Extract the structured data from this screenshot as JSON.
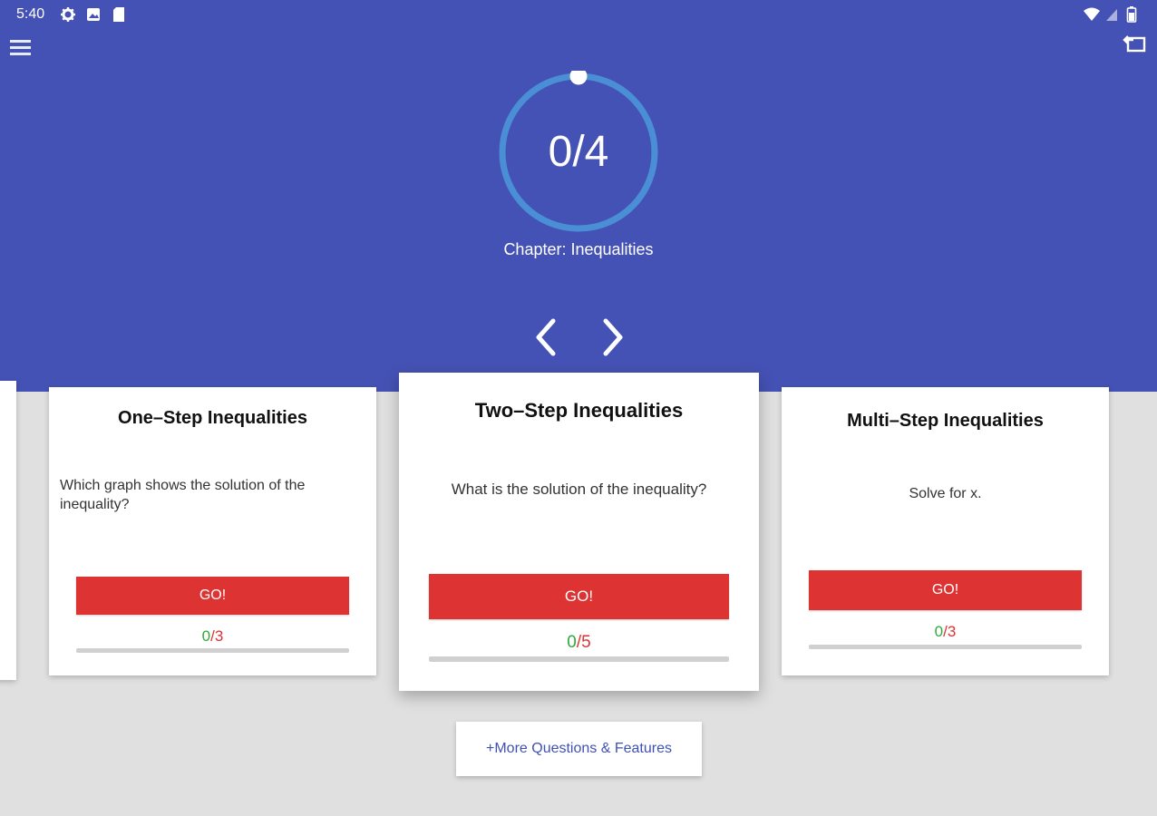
{
  "status_bar": {
    "time": "5:40",
    "left_icons": [
      "gear-icon",
      "image-icon",
      "sd-card-icon"
    ],
    "right_icons": [
      "wifi-icon",
      "signal-icon",
      "battery-icon"
    ]
  },
  "header": {
    "background_color": "#4552b5",
    "progress_text": "0/4",
    "progress_value": 0,
    "chapter_label": "Chapter: Inequalities"
  },
  "cards": [
    {
      "title": "One–Step Inequalities",
      "question": "Which graph shows the solution of the inequality?",
      "go_label": "GO!",
      "score_correct": "0",
      "score_sep": "/",
      "score_total": "3",
      "progress": 0
    },
    {
      "title": "Two–Step Inequalities",
      "question": "What is the solution of the inequality?",
      "go_label": "GO!",
      "score_correct": "0",
      "score_sep": "/",
      "score_total": "5",
      "progress": 0
    },
    {
      "title": "Multi–Step Inequalities",
      "question": "Solve for x.",
      "go_label": "GO!",
      "score_correct": "0",
      "score_sep": "/",
      "score_total": "3",
      "progress": 0
    }
  ],
  "more_button": {
    "label": "+More Questions & Features"
  },
  "colors": {
    "go_button": "#dd3333",
    "score_correct": "#2eaa3a",
    "score_total": "#dd3333",
    "ring": "#4a8fd6"
  }
}
